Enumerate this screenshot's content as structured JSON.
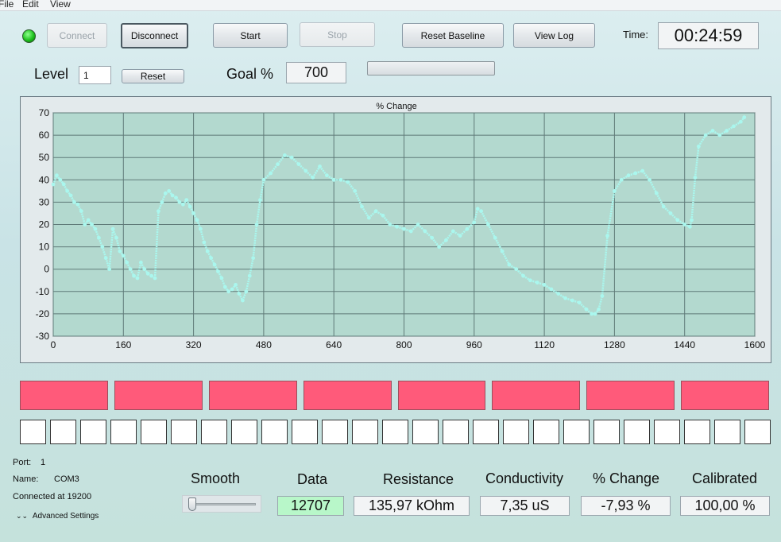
{
  "menu": [
    "File",
    "Edit",
    "View"
  ],
  "toolbar": {
    "connect": "Connect",
    "disconnect": "Disconnect",
    "start": "Start",
    "stop": "Stop",
    "reset_baseline": "Reset Baseline",
    "view_log": "View Log",
    "time_label": "Time:",
    "time_value": "00:24:59"
  },
  "level": {
    "label": "Level",
    "value": "1",
    "reset": "Reset"
  },
  "goal": {
    "label": "Goal %",
    "value": "700",
    "progress": 0
  },
  "status_color": "#1ec21e",
  "chart_data": {
    "type": "scatter",
    "title": "% Change",
    "xlabel": "",
    "ylabel": "",
    "xlim": [
      0,
      1600
    ],
    "ylim": [
      -30,
      70
    ],
    "x_ticks": [
      0,
      160,
      320,
      480,
      640,
      800,
      960,
      1120,
      1280,
      1440,
      1600
    ],
    "y_ticks": [
      -30,
      -20,
      -10,
      0,
      10,
      20,
      30,
      40,
      50,
      60,
      70
    ],
    "grid": true,
    "plot_bg": "#b3d9cf",
    "point_color": "#aaf7ee",
    "x": [
      0,
      8,
      16,
      24,
      32,
      40,
      48,
      56,
      64,
      72,
      80,
      88,
      96,
      104,
      112,
      120,
      128,
      136,
      144,
      152,
      160,
      168,
      176,
      184,
      192,
      200,
      208,
      216,
      224,
      232,
      240,
      248,
      256,
      264,
      272,
      280,
      288,
      296,
      304,
      312,
      320,
      328,
      336,
      344,
      352,
      360,
      368,
      376,
      384,
      392,
      400,
      408,
      416,
      424,
      432,
      440,
      448,
      456,
      464,
      472,
      480,
      496,
      512,
      528,
      544,
      560,
      576,
      592,
      608,
      624,
      640,
      656,
      672,
      688,
      704,
      720,
      736,
      752,
      768,
      784,
      800,
      816,
      832,
      848,
      864,
      880,
      896,
      912,
      928,
      944,
      960,
      968,
      976,
      992,
      1008,
      1024,
      1040,
      1056,
      1072,
      1088,
      1104,
      1120,
      1136,
      1152,
      1168,
      1184,
      1200,
      1216,
      1228,
      1236,
      1244,
      1252,
      1264,
      1280,
      1296,
      1312,
      1328,
      1344,
      1360,
      1376,
      1392,
      1408,
      1424,
      1440,
      1452,
      1456,
      1464,
      1472,
      1488,
      1504,
      1520,
      1536,
      1552,
      1568,
      1576
    ],
    "y": [
      38,
      42,
      40,
      38,
      35,
      33,
      30,
      29,
      26,
      20,
      22,
      20,
      18,
      14,
      10,
      5,
      0,
      18,
      14,
      8,
      6,
      3,
      0,
      -3,
      -4,
      3,
      0,
      -2,
      -3,
      -4,
      26,
      30,
      34,
      35,
      33,
      32,
      30,
      29,
      31,
      28,
      25,
      22,
      18,
      12,
      8,
      5,
      2,
      -1,
      -4,
      -8,
      -10,
      -9,
      -7,
      -11,
      -14,
      -10,
      -3,
      5,
      20,
      31,
      40,
      43,
      47,
      51,
      50,
      47,
      44,
      41,
      46,
      42,
      40,
      40,
      39,
      35,
      28,
      23,
      26,
      24,
      20,
      19,
      18,
      17,
      20,
      17,
      14,
      10,
      13,
      17,
      15,
      18,
      21,
      27,
      26,
      20,
      14,
      8,
      2,
      0,
      -3,
      -5,
      -6,
      -7,
      -9,
      -11,
      -13,
      -14,
      -15,
      -18,
      -20,
      -20,
      -18,
      -12,
      15,
      35,
      40,
      42,
      43,
      44,
      40,
      34,
      28,
      25,
      22,
      20,
      19,
      22,
      41,
      55,
      60,
      62,
      60,
      62,
      64,
      66,
      68,
      70
    ]
  },
  "indicators": {
    "red_count": 8,
    "white_count": 25,
    "red_color": "#ff5a7a"
  },
  "port": {
    "port_label": "Port:",
    "port_value": "1",
    "name_label": "Name:",
    "name_value": "COM3",
    "connected_text": "Connected at 19200",
    "advanced": "Advanced Settings"
  },
  "readouts": {
    "smooth_label": "Smooth",
    "smooth_value": 0,
    "data_label": "Data",
    "data_value": "12707",
    "resistance_label": "Resistance",
    "resistance_value": "135,97 kOhm",
    "conductivity_label": "Conductivity",
    "conductivity_value": "7,35 uS",
    "change_label": "% Change",
    "change_value": "-7,93 %",
    "calibrated_label": "Calibrated",
    "calibrated_value": "100,00 %",
    "data_bg": "#b8f7c9"
  }
}
